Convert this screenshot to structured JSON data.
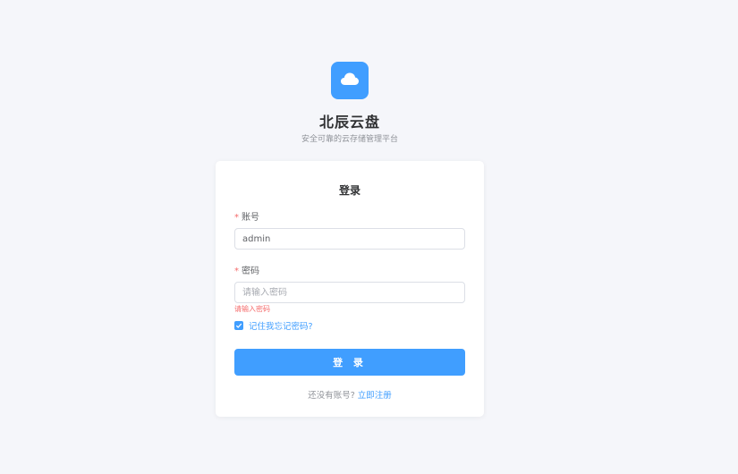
{
  "app": {
    "title": "北辰云盘",
    "subtitle": "安全可靠的云存储管理平台",
    "logo_icon": "cloud-icon",
    "accent": "#409eff"
  },
  "login": {
    "card_title": "登录",
    "account_label": "账号",
    "account_value": "admin",
    "password_label": "密码",
    "password_placeholder": "请输入密码",
    "password_error": "请输入密码",
    "remember_label": "记住我忘记密码?",
    "remember_checked": true,
    "submit_label": "登 录",
    "register_prompt": "还没有账号?",
    "register_link": "立即注册"
  }
}
